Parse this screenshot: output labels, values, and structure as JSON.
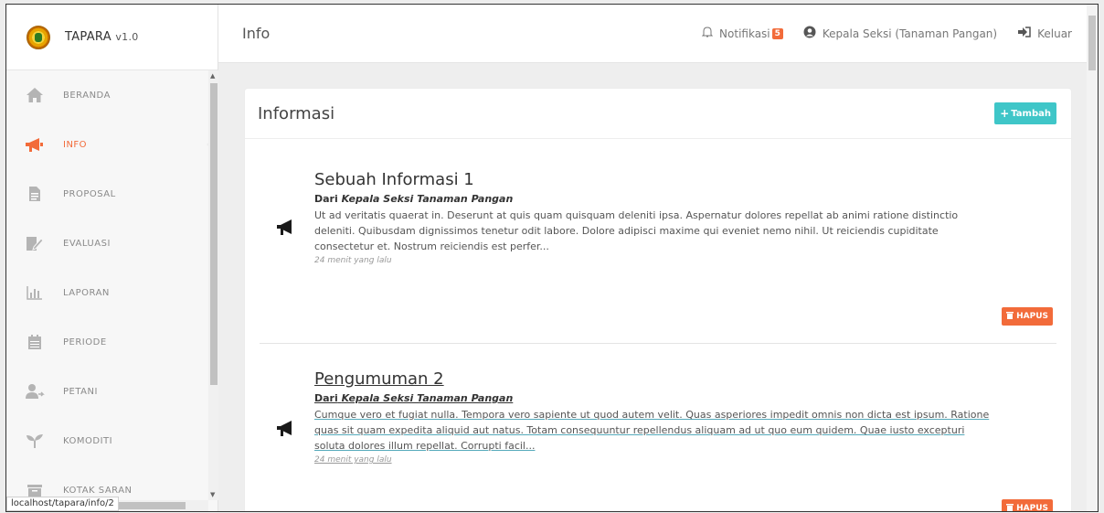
{
  "brand": {
    "name": "TAPARA",
    "version": "v1.0"
  },
  "sidebar": {
    "items": [
      {
        "label": "BERANDA",
        "icon": "home-icon"
      },
      {
        "label": "INFO",
        "icon": "megaphone-icon",
        "active": true
      },
      {
        "label": "PROPOSAL",
        "icon": "document-icon"
      },
      {
        "label": "EVALUASI",
        "icon": "edit-icon"
      },
      {
        "label": "LAPORAN",
        "icon": "bar-chart-icon"
      },
      {
        "label": "PERIODE",
        "icon": "calendar-icon"
      },
      {
        "label": "PETANI",
        "icon": "users-icon"
      },
      {
        "label": "KOMODITI",
        "icon": "sprout-icon"
      },
      {
        "label": "KOTAK SARAN",
        "icon": "inbox-icon"
      }
    ]
  },
  "status_url": "localhost/tapara/info/2",
  "header": {
    "title": "Info",
    "notification_label": "Notifikasi",
    "notification_count": "5",
    "user_label": "Kepala Seksi (Tanaman Pangan)",
    "logout_label": "Keluar"
  },
  "content": {
    "title": "Informasi",
    "add_label": "Tambah",
    "delete_label": "HAPUS",
    "items": [
      {
        "title": "Sebuah Informasi 1",
        "from_prefix": "Dari",
        "from": "Kepala Seksi Tanaman Pangan",
        "body": "Ut ad veritatis quaerat in. Deserunt at quis quam quisquam deleniti ipsa. Aspernatur dolores repellat ab animi ratione distinctio deleniti. Quibusdam dignissimos tenetur odit labore. Dolore adipisci maxime qui eveniet nemo nihil. Ut reiciendis cupiditate consectetur et. Nostrum reiciendis est perfer...",
        "time": "24 menit yang lalu"
      },
      {
        "title": "Pengumuman 2",
        "from_prefix": "Dari",
        "from": "Kepala Seksi Tanaman Pangan",
        "body": "Cumque vero et fugiat nulla. Tempora vero sapiente ut quod autem velit. Quas asperiores impedit omnis non dicta est ipsum. Ratione quas sit quam expedita aliquid aut natus. Totam consequuntur repellendus aliquam ad ut quo eum quidem. Quae iusto excepturi soluta dolores illum repellat. Corrupti facil...",
        "time": "24 menit yang lalu"
      }
    ]
  },
  "colors": {
    "accent": "#f26b3a",
    "teal": "#3fc6c8"
  }
}
